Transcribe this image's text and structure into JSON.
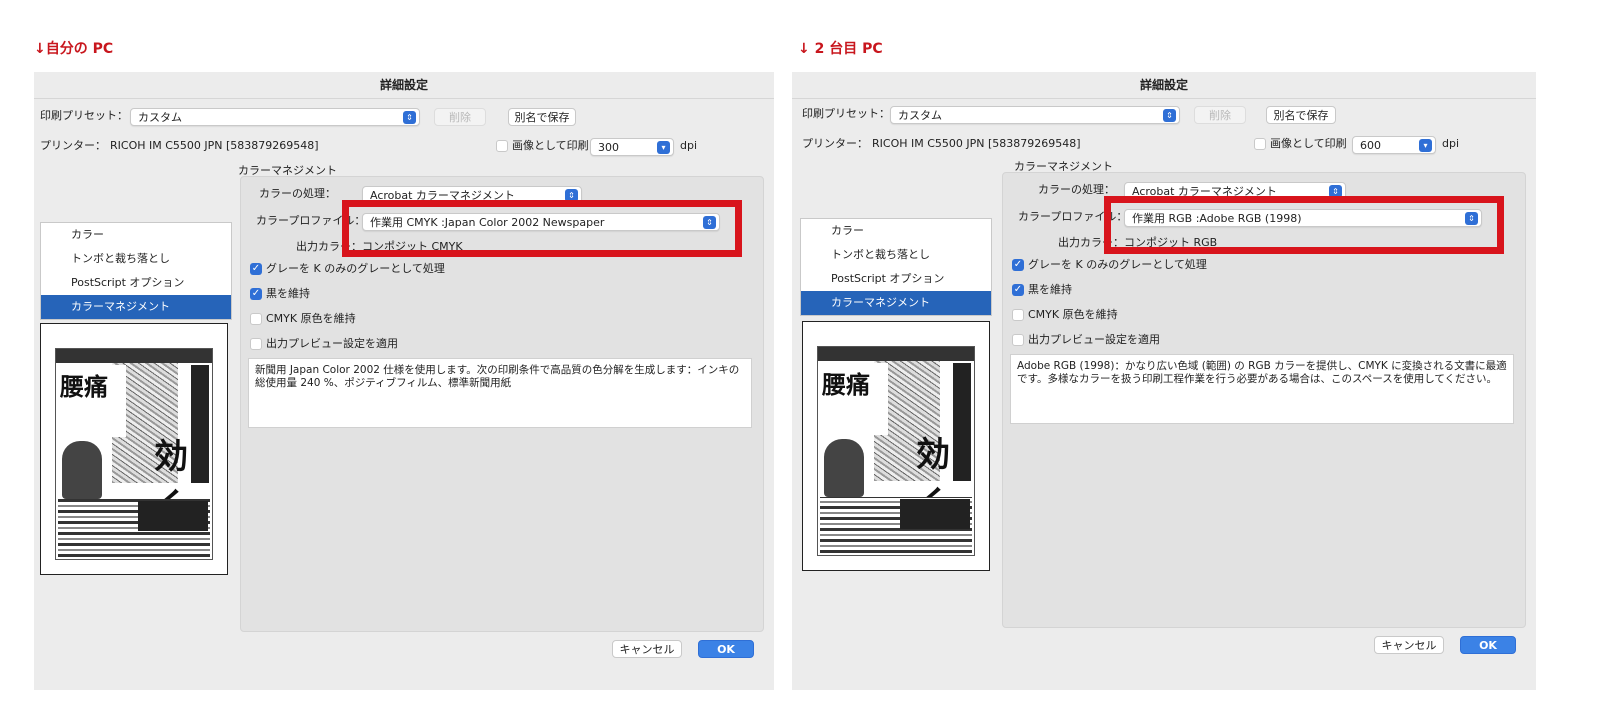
{
  "left": {
    "caption": "↓自分の PC",
    "dialog_title": "詳細設定",
    "preset_label": "印刷プリセット：",
    "preset_value": "カスタム",
    "delete_label": "削除",
    "save_as_label": "別名で保存",
    "printer_label": "プリンター：",
    "printer_value": "RICOH IM C5500 JPN [583879269548]",
    "print_as_image_label": "画像として印刷",
    "dpi_value": "300",
    "dpi_unit": "dpi",
    "section_title": "カラーマネジメント",
    "color_handling_label": "カラーの処理：",
    "color_handling_value": "Acrobat カラーマネジメント",
    "color_profile_label": "カラープロファイル：",
    "color_profile_value": "作業用 CMYK :Japan Color 2002 Newspaper",
    "output_color_label": "出力カラー：",
    "output_color_value": "コンポジット CMYK",
    "gray_k_label": "グレーを K のみのグレーとして処理",
    "gray_k_checked": true,
    "preserve_black_label": "黒を維持",
    "preserve_black_checked": true,
    "cmyk_primaries_label": "CMYK 原色を維持",
    "cmyk_primaries_checked": false,
    "output_preview_label": "出力プレビュー設定を適用",
    "output_preview_checked": false,
    "description": "新聞用 Japan Color 2002 仕様を使用します。次の印刷条件で高品質の色分解を生成します：インキの総使用量 240 %、ポジティブフィルム、標準新聞用紙",
    "nav": [
      "カラー",
      "トンボと裁ち落とし",
      "PostScript オプション",
      "カラーマネジメント"
    ],
    "cancel_label": "キャンセル",
    "ok_label": "OK"
  },
  "right": {
    "caption": "↓ 2 台目 PC",
    "dialog_title": "詳細設定",
    "preset_label": "印刷プリセット：",
    "preset_value": "カスタム",
    "delete_label": "削除",
    "save_as_label": "別名で保存",
    "printer_label": "プリンター：",
    "printer_value": "RICOH IM C5500 JPN [583879269548]",
    "print_as_image_label": "画像として印刷",
    "dpi_value": "600",
    "dpi_unit": "dpi",
    "section_title": "カラーマネジメント",
    "color_handling_label": "カラーの処理：",
    "color_handling_value": "Acrobat カラーマネジメント",
    "color_profile_label": "カラープロファイル：",
    "color_profile_value": "作業用 RGB :Adobe RGB (1998)",
    "output_color_label": "出力カラー：",
    "output_color_value": "コンポジット RGB",
    "gray_k_label": "グレーを K のみのグレーとして処理",
    "gray_k_checked": true,
    "preserve_black_label": "黒を維持",
    "preserve_black_checked": true,
    "cmyk_primaries_label": "CMYK 原色を維持",
    "cmyk_primaries_checked": false,
    "output_preview_label": "出力プレビュー設定を適用",
    "output_preview_checked": false,
    "description": "Adobe RGB (1998)：かなり広い色域 (範囲) の RGB カラーを提供し、CMYK に変換される文書に最適です。多様なカラーを扱う印刷工程作業を行う必要がある場合は、このスペースを使用してください。",
    "nav": [
      "カラー",
      "トンボと裁ち落とし",
      "PostScript オプション",
      "カラーマネジメント"
    ],
    "cancel_label": "キャンセル",
    "ok_label": "OK"
  },
  "thumbnail": {
    "headline_1": "腰痛",
    "headline_2": "効く"
  },
  "colors": {
    "caption_red": "#c8161d",
    "highlight_red": "#d8141c",
    "accent_blue": "#2f6fd6",
    "selected_nav": "#2664b9",
    "panel_bg": "#ececec"
  }
}
